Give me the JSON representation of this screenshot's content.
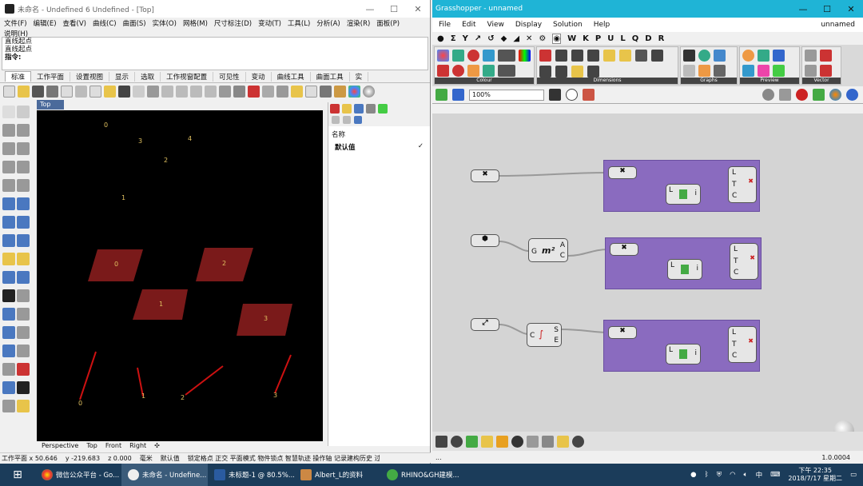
{
  "rhino": {
    "title": "未命名 - Undefined 6 Undefined - [Top]",
    "menu": [
      "文件(F)",
      "编辑(E)",
      "查看(V)",
      "曲线(C)",
      "曲面(S)",
      "实体(O)",
      "网格(M)",
      "尺寸标注(D)",
      "变动(T)",
      "工具(L)",
      "分析(A)",
      "渲染(R)",
      "面板(P)",
      "说明(H)"
    ],
    "cmd_lines": [
      "直线起点",
      "直线起点"
    ],
    "cmd_prompt": "指令:",
    "tabs": [
      "标准",
      "工作平面",
      "设置视图",
      "显示",
      "选取",
      "工作视窗配置",
      "可见性",
      "变动",
      "曲线工具",
      "曲面工具",
      "实"
    ],
    "viewport_label": "Top",
    "viewport_tabs": [
      "Perspective",
      "Top",
      "Front",
      "Right"
    ],
    "panel_header": "名称",
    "panel_item": "默认值",
    "status": {
      "x": "工作平面 x 50.646",
      "y": "y -219.683",
      "z": "z 0.000",
      "unit": "毫米",
      "layer": "默认值",
      "modes": "锁定格点 正交 平面模式 物件锁点 智慧轨迹 操作轴 记录建构历史 过滤器"
    },
    "points": [
      {
        "label": "0",
        "x": 0.24,
        "y": 0.05
      },
      {
        "label": "3",
        "x": 0.36,
        "y": 0.095
      },
      {
        "label": "4",
        "x": 0.52,
        "y": 0.085
      },
      {
        "label": "2",
        "x": 0.44,
        "y": 0.16
      },
      {
        "label": "1",
        "x": 0.3,
        "y": 0.27
      }
    ],
    "surfaces": [
      "0",
      "2",
      "1",
      "3"
    ],
    "lines": [
      "0",
      "1",
      "2",
      "3"
    ]
  },
  "gh": {
    "title": "Grasshopper - unnamed",
    "menu": [
      "File",
      "Edit",
      "View",
      "Display",
      "Solution",
      "Help"
    ],
    "doc_name": "unnamed",
    "letters": [
      "W",
      "K",
      "P",
      "U",
      "L",
      "Q",
      "D",
      "R"
    ],
    "ribbon_groups": [
      "Colour",
      "Dimensions",
      "Graphs",
      "Preview",
      "Vector"
    ],
    "zoom": "100%",
    "version": "1.0.0004",
    "status_left": "..."
  },
  "taskbar": {
    "apps": [
      "微信公众平台 - Go...",
      "未命名 - Undefine...",
      "未标题-1 @ 80.5%...",
      "Albert_L的资料",
      "RHINO&GH建模..."
    ],
    "ime": "中",
    "time": "下午 22:35",
    "date": "2018/7/17 星期二"
  }
}
